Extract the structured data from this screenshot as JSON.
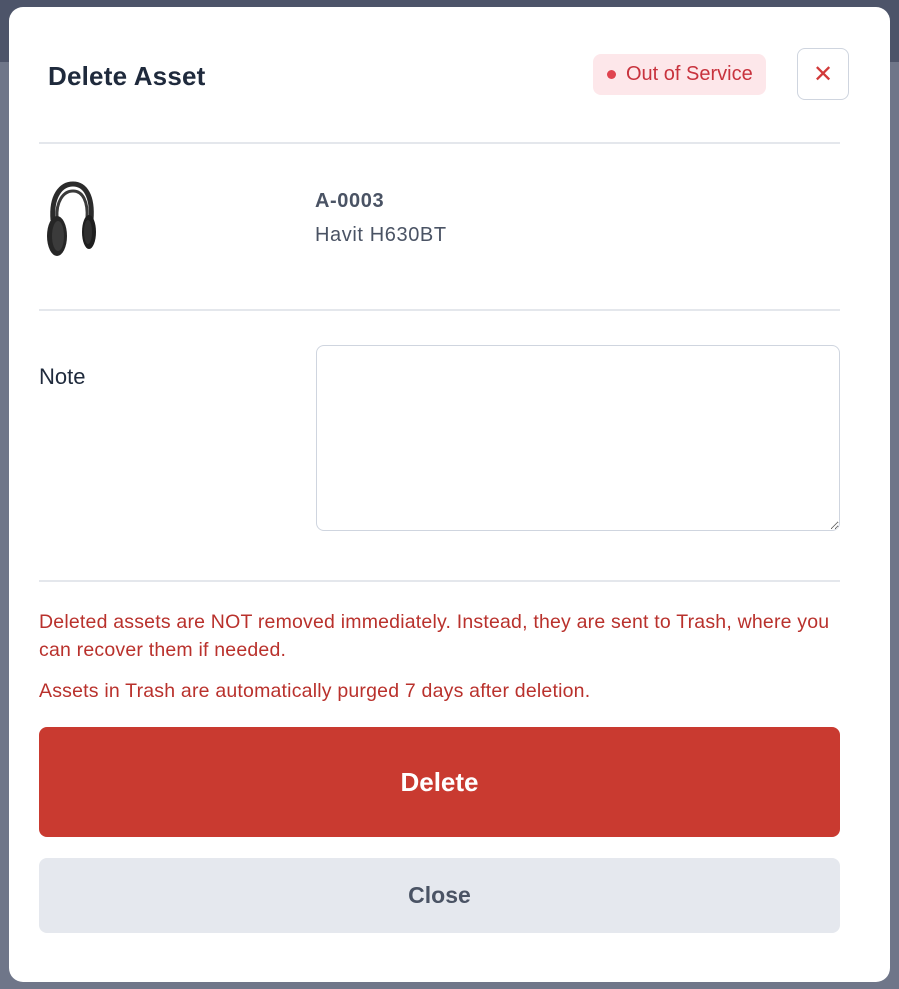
{
  "modal": {
    "title": "Delete Asset",
    "status_badge": "Out of Service",
    "close_icon": "close-icon"
  },
  "asset": {
    "id": "A-0003",
    "name": "Havit H630BT",
    "thumbnail_icon": "headphones-image"
  },
  "note": {
    "label": "Note",
    "value": ""
  },
  "warnings": [
    "Deleted assets are NOT removed immediately. Instead, they are sent to Trash, where you can recover them if needed.",
    "Assets in Trash are automatically purged 7 days after deletion."
  ],
  "buttons": {
    "delete_label": "Delete",
    "close_label": "Close"
  },
  "colors": {
    "danger": "#c93a30",
    "status_text": "#c8323d",
    "status_bg": "#fde7ea",
    "secondary_bg": "#e5e8ee"
  }
}
